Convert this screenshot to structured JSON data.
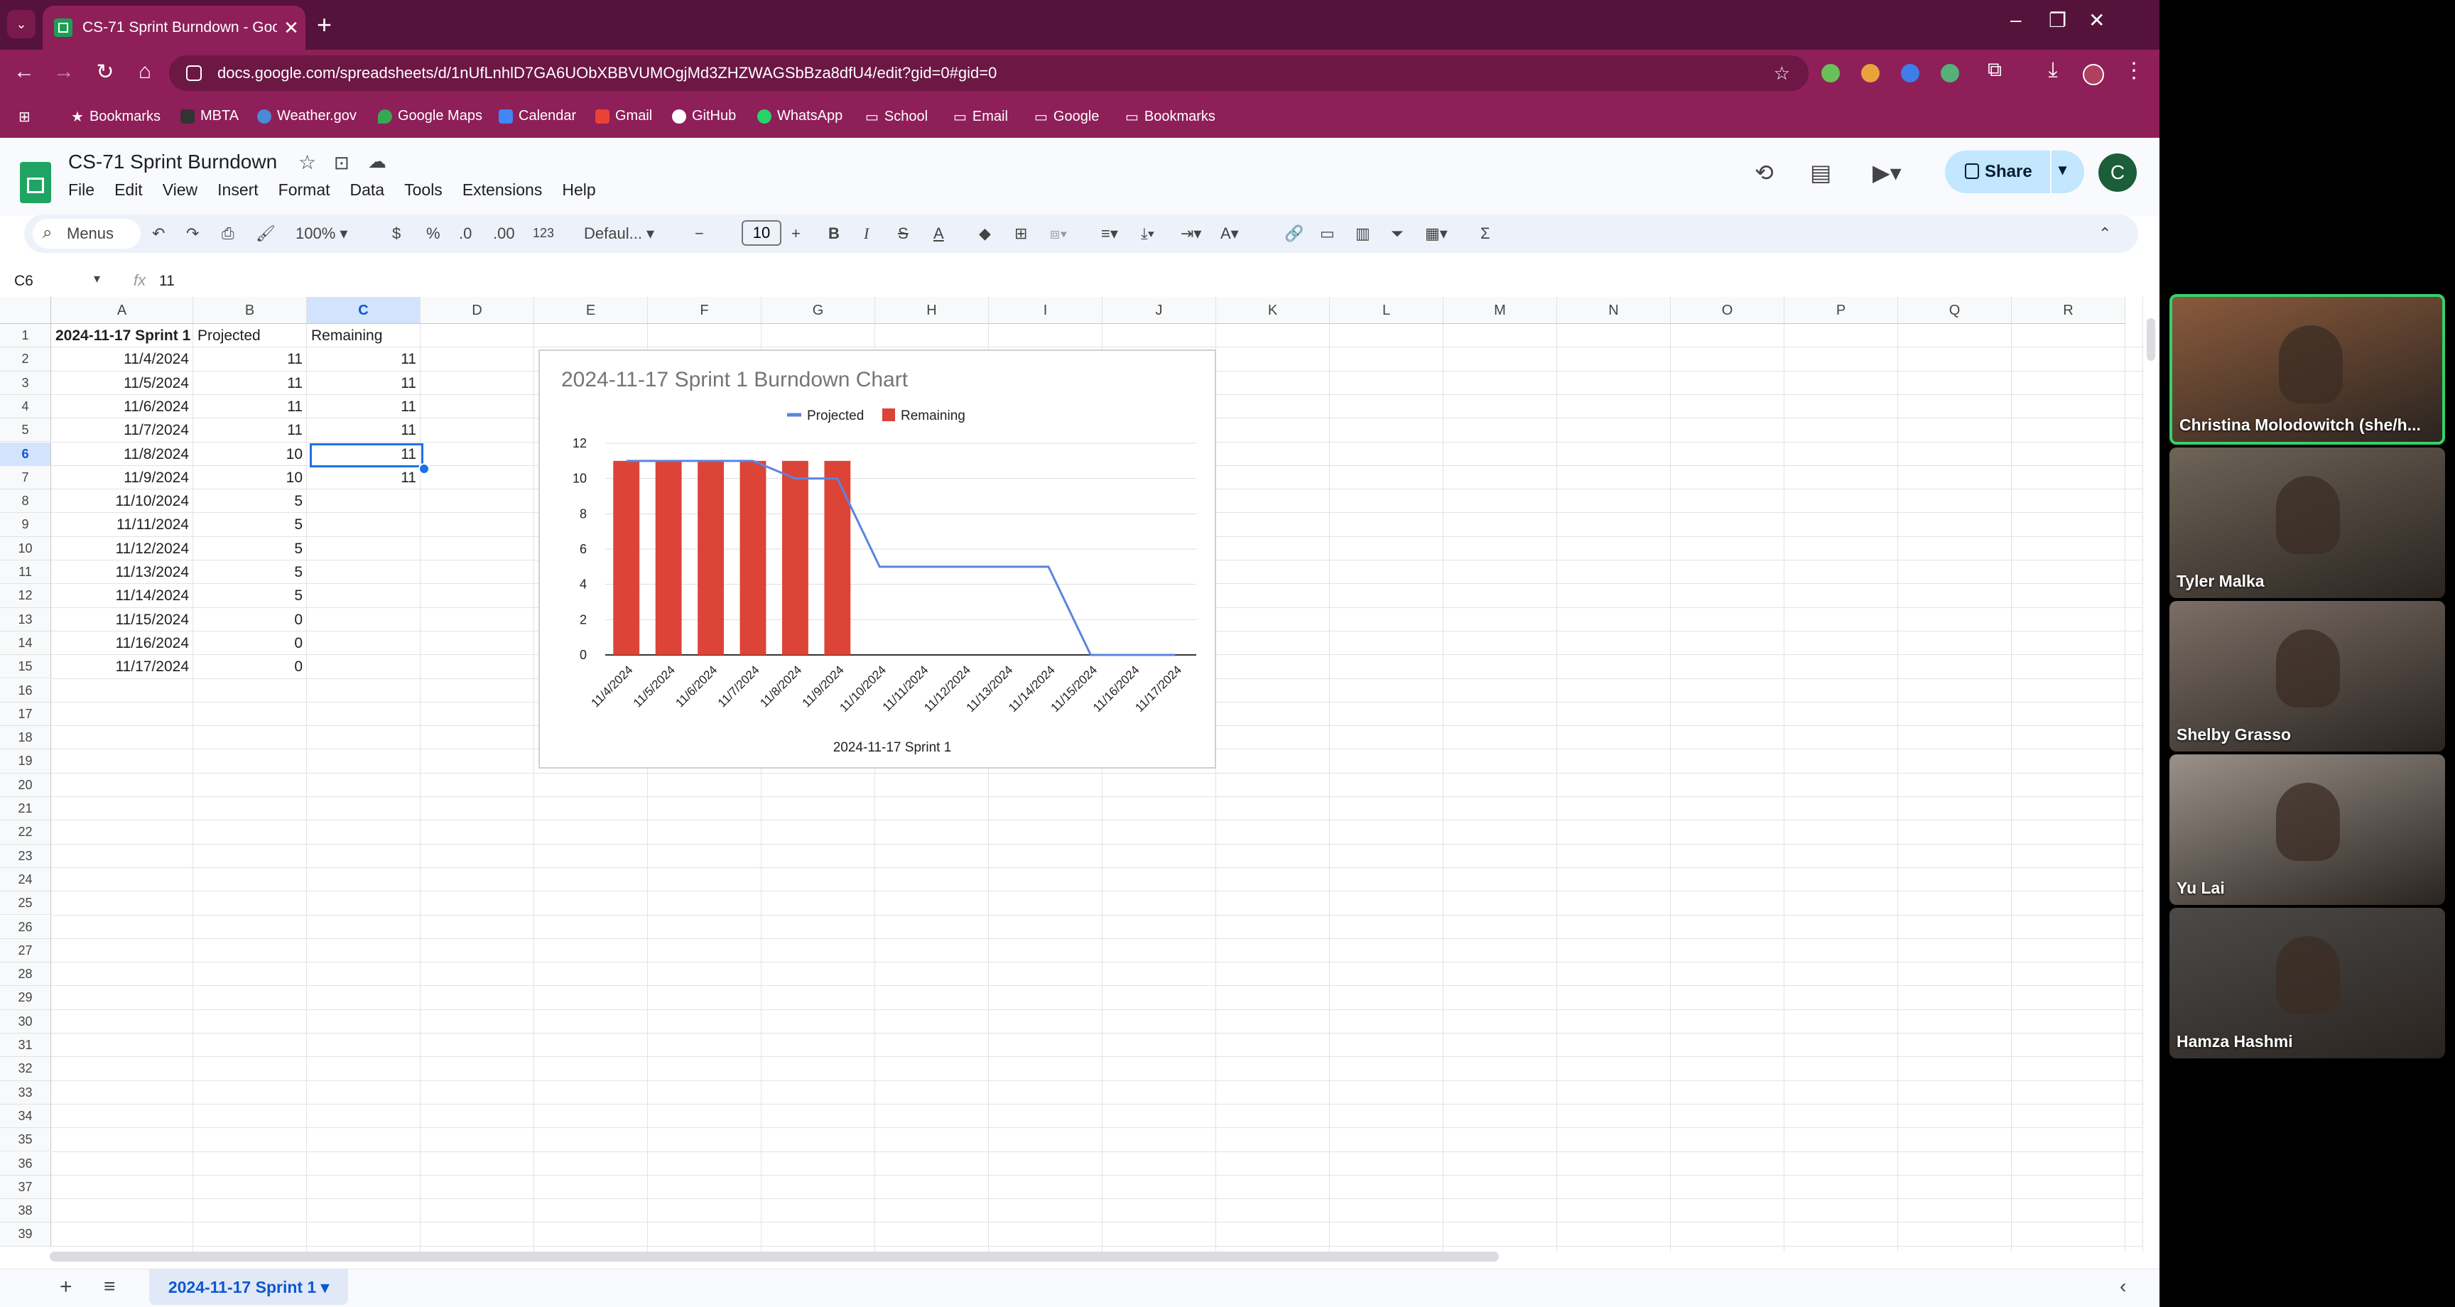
{
  "browser": {
    "tab_title": "CS-71 Sprint Burndown - Goog",
    "url": "docs.google.com/spreadsheets/d/1nUfLnhlD7GA6UObXBBVUMOgjMd3ZHZWAGSbBza8dfU4/edit?gid=0#gid=0",
    "bookmarks": [
      "Bookmarks",
      "MBTA",
      "Weather.gov",
      "Google Maps",
      "Calendar",
      "Gmail",
      "GitHub",
      "WhatsApp",
      "School",
      "Email",
      "Google",
      "Bookmarks"
    ]
  },
  "doc": {
    "title": "CS-71 Sprint Burndown",
    "menus": [
      "File",
      "Edit",
      "View",
      "Insert",
      "Format",
      "Data",
      "Tools",
      "Extensions",
      "Help"
    ],
    "share_label": "Share",
    "avatar_letter": "C"
  },
  "toolbar": {
    "menus_label": "Menus",
    "zoom": "100%",
    "currency": "$",
    "percent": "%",
    "dec_less": ".0",
    "dec_more": ".00",
    "number_format": "123",
    "font": "Defaul...",
    "font_size": "10"
  },
  "formula_bar": {
    "name_box": "C6",
    "fx": "fx",
    "value": "11"
  },
  "grid": {
    "columns": [
      "A",
      "B",
      "C",
      "D",
      "E",
      "F",
      "G",
      "H",
      "I",
      "J",
      "K",
      "L",
      "M",
      "N",
      "O",
      "P",
      "Q",
      "R"
    ],
    "rows": [
      "1",
      "2",
      "3",
      "4",
      "5",
      "6",
      "7",
      "8",
      "9",
      "10",
      "11",
      "12",
      "13",
      "14",
      "15",
      "16",
      "17",
      "18",
      "19",
      "20",
      "21",
      "22",
      "23",
      "24",
      "25",
      "26",
      "27",
      "28",
      "29",
      "30",
      "31",
      "32",
      "33",
      "34",
      "35",
      "36",
      "37",
      "38",
      "39"
    ],
    "header": [
      "2024-11-17 Sprint 1",
      "Projected",
      "Remaining"
    ],
    "data": [
      [
        "11/4/2024",
        "11",
        "11"
      ],
      [
        "11/5/2024",
        "11",
        "11"
      ],
      [
        "11/6/2024",
        "11",
        "11"
      ],
      [
        "11/7/2024",
        "11",
        "11"
      ],
      [
        "11/8/2024",
        "10",
        "11"
      ],
      [
        "11/9/2024",
        "10",
        "11"
      ],
      [
        "11/10/2024",
        "5",
        ""
      ],
      [
        "11/11/2024",
        "5",
        ""
      ],
      [
        "11/12/2024",
        "5",
        ""
      ],
      [
        "11/13/2024",
        "5",
        ""
      ],
      [
        "11/14/2024",
        "5",
        ""
      ],
      [
        "11/15/2024",
        "0",
        ""
      ],
      [
        "11/16/2024",
        "0",
        ""
      ],
      [
        "11/17/2024",
        "0",
        ""
      ]
    ]
  },
  "chart_data": {
    "type": "bar",
    "title": "2024-11-17 Sprint 1 Burndown Chart",
    "xlabel": "2024-11-17 Sprint 1",
    "ylabel": "",
    "ylim": [
      0,
      12
    ],
    "yticks": [
      "0",
      "2",
      "4",
      "6",
      "8",
      "10",
      "12"
    ],
    "legend": "top",
    "categories": [
      "11/4/2024",
      "11/5/2024",
      "11/6/2024",
      "11/7/2024",
      "11/8/2024",
      "11/9/2024",
      "11/10/2024",
      "11/11/2024",
      "11/12/2024",
      "11/13/2024",
      "11/14/2024",
      "11/15/2024",
      "11/16/2024",
      "11/17/2024"
    ],
    "series": [
      {
        "name": "Projected",
        "kind": "line",
        "color": "#5b84e0",
        "values": [
          11,
          11,
          11,
          11,
          10,
          10,
          5,
          5,
          5,
          5,
          5,
          0,
          0,
          0
        ]
      },
      {
        "name": "Remaining",
        "kind": "bar",
        "color": "#db4437",
        "values": [
          11,
          11,
          11,
          11,
          11,
          11,
          null,
          null,
          null,
          null,
          null,
          null,
          null,
          null
        ]
      }
    ]
  },
  "sheet_tab": "2024-11-17 Sprint 1",
  "participants": [
    {
      "name": "Christina Molodowitch (she/h...",
      "bg": "#8a5a3c"
    },
    {
      "name": "Tyler Malka",
      "bg": "#6e6458"
    },
    {
      "name": "Shelby Grasso",
      "bg": "#7b6f66"
    },
    {
      "name": "Yu Lai",
      "bg": "#9a9189"
    },
    {
      "name": "Hamza Hashmi",
      "bg": "#4c4a48"
    }
  ]
}
